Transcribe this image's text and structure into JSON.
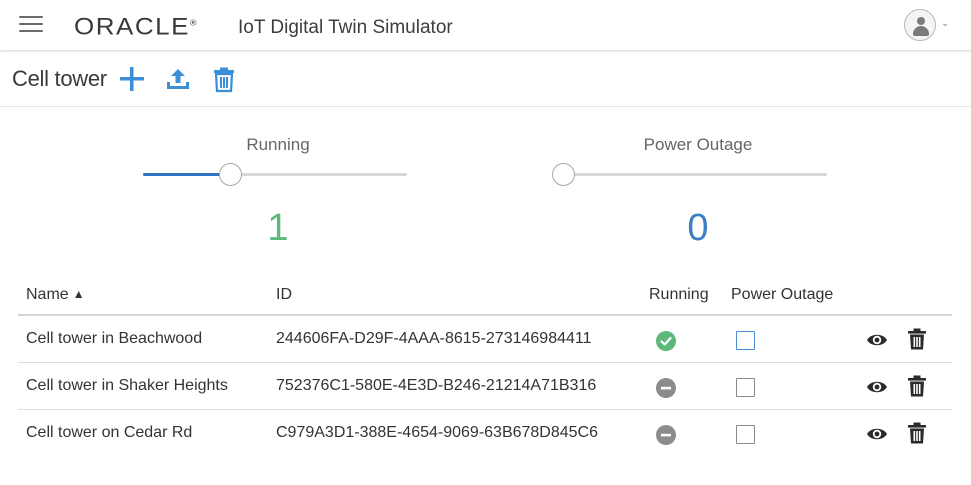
{
  "header": {
    "logo": "ORACLE",
    "logo_mark": "®",
    "app_title": "IoT Digital Twin Simulator"
  },
  "toolbar": {
    "title": "Cell tower",
    "add_icon": "plus-icon",
    "upload_icon": "upload-icon",
    "delete_icon": "trash-icon"
  },
  "sliders": {
    "running": {
      "label": "Running",
      "value": "1",
      "fraction": 0.33,
      "color": "#5db979"
    },
    "outage": {
      "label": "Power Outage",
      "value": "0",
      "fraction": 0.0,
      "color": "#3a7fc3"
    }
  },
  "table": {
    "headers": {
      "name": "Name",
      "sort": "▲",
      "id": "ID",
      "running": "Running",
      "outage": "Power Outage"
    },
    "rows": [
      {
        "name": "Cell tower in Beachwood",
        "id": "244606FA-D29F-4AAA-8615-273146984411",
        "running": true,
        "outage": false
      },
      {
        "name": "Cell tower in Shaker Heights",
        "id": "752376C1-580E-4E3D-B246-21214A71B316",
        "running": false,
        "outage": false
      },
      {
        "name": "Cell tower on Cedar Rd",
        "id": "C979A3D1-388E-4654-9069-63B678D845C6",
        "running": false,
        "outage": false
      }
    ]
  },
  "colors": {
    "accent": "#2f74c0",
    "icon_blue": "#3a8fd6",
    "running_ok": "#5db979",
    "stopped": "#8c8c8c"
  }
}
